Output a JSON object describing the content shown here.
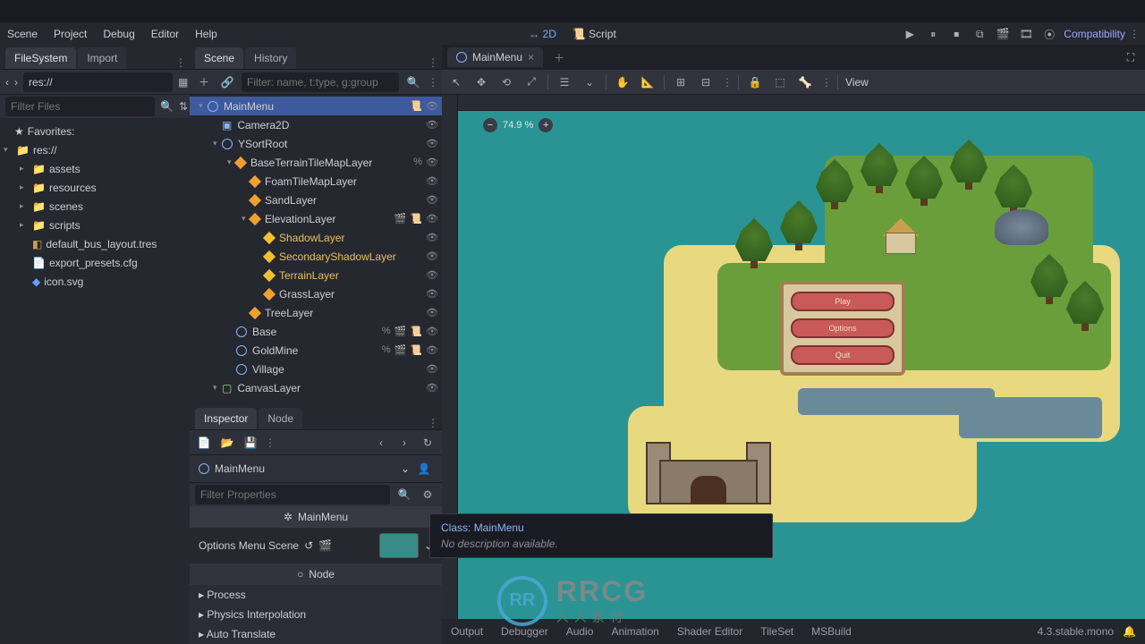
{
  "menubar": {
    "items": [
      "Scene",
      "Project",
      "Debug",
      "Editor",
      "Help"
    ],
    "center": {
      "mode2d": "2D",
      "script": "Script"
    },
    "compat": "Compatibility"
  },
  "filesystem": {
    "tabs": {
      "fs": "FileSystem",
      "import": "Import"
    },
    "path": "res://",
    "filter_placeholder": "Filter Files",
    "favorites": "Favorites:",
    "root": "res://",
    "folders": [
      "assets",
      "resources",
      "scenes",
      "scripts"
    ],
    "files": [
      "default_bus_layout.tres",
      "export_presets.cfg",
      "icon.svg"
    ]
  },
  "scene": {
    "tabs": {
      "scene": "Scene",
      "history": "History"
    },
    "filter_placeholder": "Filter: name, t:type, g:group",
    "nodes": [
      {
        "name": "MainMenu",
        "depth": 0,
        "kind": "circ",
        "sel": true,
        "caret": "▾",
        "script": true
      },
      {
        "name": "Camera2D",
        "depth": 1,
        "kind": "cam",
        "caret": ""
      },
      {
        "name": "YSortRoot",
        "depth": 1,
        "kind": "circ",
        "caret": "▾"
      },
      {
        "name": "BaseTerrainTileMapLayer",
        "depth": 2,
        "kind": "diam",
        "caret": "▾",
        "pct": true
      },
      {
        "name": "FoamTileMapLayer",
        "depth": 3,
        "kind": "diam",
        "caret": ""
      },
      {
        "name": "SandLayer",
        "depth": 3,
        "kind": "diam",
        "caret": ""
      },
      {
        "name": "ElevationLayer",
        "depth": 3,
        "kind": "diam",
        "caret": "▾",
        "extra": true
      },
      {
        "name": "ShadowLayer",
        "depth": 4,
        "kind": "diam",
        "caret": "",
        "yellow": true
      },
      {
        "name": "SecondaryShadowLayer",
        "depth": 4,
        "kind": "diam",
        "caret": "",
        "yellow": true
      },
      {
        "name": "TerrainLayer",
        "depth": 4,
        "kind": "diam",
        "caret": "",
        "yellow": true
      },
      {
        "name": "GrassLayer",
        "depth": 4,
        "kind": "diam",
        "caret": ""
      },
      {
        "name": "TreeLayer",
        "depth": 3,
        "kind": "diam",
        "caret": ""
      },
      {
        "name": "Base",
        "depth": 2,
        "kind": "circ",
        "caret": "",
        "pct": true,
        "extra": true
      },
      {
        "name": "GoldMine",
        "depth": 2,
        "kind": "circ",
        "caret": "",
        "pct": true,
        "extra": true
      },
      {
        "name": "Village",
        "depth": 2,
        "kind": "circ",
        "caret": ""
      },
      {
        "name": "CanvasLayer",
        "depth": 1,
        "kind": "sq",
        "caret": "▾"
      }
    ]
  },
  "inspector": {
    "tabs": {
      "inspector": "Inspector",
      "node": "Node"
    },
    "object": "MainMenu",
    "filter_placeholder": "Filter Properties",
    "header": "MainMenu",
    "opt_label": "Options Menu Scene",
    "node_header": "Node",
    "folds": [
      "Process",
      "Physics Interpolation",
      "Auto Translate"
    ]
  },
  "viewport": {
    "tab": "MainMenu",
    "view_label": "View",
    "zoom": "74.9 %",
    "menu_buttons": [
      "Play",
      "Options",
      "Quit"
    ]
  },
  "tooltip": {
    "class_prefix": "Class: ",
    "class_name": "MainMenu",
    "desc": "No description available."
  },
  "bottom": {
    "items": [
      "Output",
      "Debugger",
      "Audio",
      "Animation",
      "Shader Editor",
      "TileSet",
      "MSBuild"
    ],
    "version": "4.3.stable.mono"
  },
  "watermark": {
    "logo_text": "RR",
    "text": "RRCG",
    "sub": "人人素材"
  }
}
